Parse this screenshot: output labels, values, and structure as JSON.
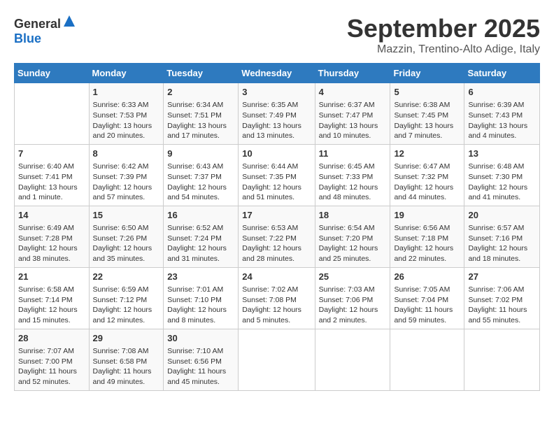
{
  "header": {
    "logo_general": "General",
    "logo_blue": "Blue",
    "month": "September 2025",
    "location": "Mazzin, Trentino-Alto Adige, Italy"
  },
  "days_of_week": [
    "Sunday",
    "Monday",
    "Tuesday",
    "Wednesday",
    "Thursday",
    "Friday",
    "Saturday"
  ],
  "weeks": [
    [
      {
        "day": "",
        "content": ""
      },
      {
        "day": "1",
        "content": "Sunrise: 6:33 AM\nSunset: 7:53 PM\nDaylight: 13 hours and 20 minutes."
      },
      {
        "day": "2",
        "content": "Sunrise: 6:34 AM\nSunset: 7:51 PM\nDaylight: 13 hours and 17 minutes."
      },
      {
        "day": "3",
        "content": "Sunrise: 6:35 AM\nSunset: 7:49 PM\nDaylight: 13 hours and 13 minutes."
      },
      {
        "day": "4",
        "content": "Sunrise: 6:37 AM\nSunset: 7:47 PM\nDaylight: 13 hours and 10 minutes."
      },
      {
        "day": "5",
        "content": "Sunrise: 6:38 AM\nSunset: 7:45 PM\nDaylight: 13 hours and 7 minutes."
      },
      {
        "day": "6",
        "content": "Sunrise: 6:39 AM\nSunset: 7:43 PM\nDaylight: 13 hours and 4 minutes."
      }
    ],
    [
      {
        "day": "7",
        "content": "Sunrise: 6:40 AM\nSunset: 7:41 PM\nDaylight: 13 hours and 1 minute."
      },
      {
        "day": "8",
        "content": "Sunrise: 6:42 AM\nSunset: 7:39 PM\nDaylight: 12 hours and 57 minutes."
      },
      {
        "day": "9",
        "content": "Sunrise: 6:43 AM\nSunset: 7:37 PM\nDaylight: 12 hours and 54 minutes."
      },
      {
        "day": "10",
        "content": "Sunrise: 6:44 AM\nSunset: 7:35 PM\nDaylight: 12 hours and 51 minutes."
      },
      {
        "day": "11",
        "content": "Sunrise: 6:45 AM\nSunset: 7:33 PM\nDaylight: 12 hours and 48 minutes."
      },
      {
        "day": "12",
        "content": "Sunrise: 6:47 AM\nSunset: 7:32 PM\nDaylight: 12 hours and 44 minutes."
      },
      {
        "day": "13",
        "content": "Sunrise: 6:48 AM\nSunset: 7:30 PM\nDaylight: 12 hours and 41 minutes."
      }
    ],
    [
      {
        "day": "14",
        "content": "Sunrise: 6:49 AM\nSunset: 7:28 PM\nDaylight: 12 hours and 38 minutes."
      },
      {
        "day": "15",
        "content": "Sunrise: 6:50 AM\nSunset: 7:26 PM\nDaylight: 12 hours and 35 minutes."
      },
      {
        "day": "16",
        "content": "Sunrise: 6:52 AM\nSunset: 7:24 PM\nDaylight: 12 hours and 31 minutes."
      },
      {
        "day": "17",
        "content": "Sunrise: 6:53 AM\nSunset: 7:22 PM\nDaylight: 12 hours and 28 minutes."
      },
      {
        "day": "18",
        "content": "Sunrise: 6:54 AM\nSunset: 7:20 PM\nDaylight: 12 hours and 25 minutes."
      },
      {
        "day": "19",
        "content": "Sunrise: 6:56 AM\nSunset: 7:18 PM\nDaylight: 12 hours and 22 minutes."
      },
      {
        "day": "20",
        "content": "Sunrise: 6:57 AM\nSunset: 7:16 PM\nDaylight: 12 hours and 18 minutes."
      }
    ],
    [
      {
        "day": "21",
        "content": "Sunrise: 6:58 AM\nSunset: 7:14 PM\nDaylight: 12 hours and 15 minutes."
      },
      {
        "day": "22",
        "content": "Sunrise: 6:59 AM\nSunset: 7:12 PM\nDaylight: 12 hours and 12 minutes."
      },
      {
        "day": "23",
        "content": "Sunrise: 7:01 AM\nSunset: 7:10 PM\nDaylight: 12 hours and 8 minutes."
      },
      {
        "day": "24",
        "content": "Sunrise: 7:02 AM\nSunset: 7:08 PM\nDaylight: 12 hours and 5 minutes."
      },
      {
        "day": "25",
        "content": "Sunrise: 7:03 AM\nSunset: 7:06 PM\nDaylight: 12 hours and 2 minutes."
      },
      {
        "day": "26",
        "content": "Sunrise: 7:05 AM\nSunset: 7:04 PM\nDaylight: 11 hours and 59 minutes."
      },
      {
        "day": "27",
        "content": "Sunrise: 7:06 AM\nSunset: 7:02 PM\nDaylight: 11 hours and 55 minutes."
      }
    ],
    [
      {
        "day": "28",
        "content": "Sunrise: 7:07 AM\nSunset: 7:00 PM\nDaylight: 11 hours and 52 minutes."
      },
      {
        "day": "29",
        "content": "Sunrise: 7:08 AM\nSunset: 6:58 PM\nDaylight: 11 hours and 49 minutes."
      },
      {
        "day": "30",
        "content": "Sunrise: 7:10 AM\nSunset: 6:56 PM\nDaylight: 11 hours and 45 minutes."
      },
      {
        "day": "",
        "content": ""
      },
      {
        "day": "",
        "content": ""
      },
      {
        "day": "",
        "content": ""
      },
      {
        "day": "",
        "content": ""
      }
    ]
  ]
}
